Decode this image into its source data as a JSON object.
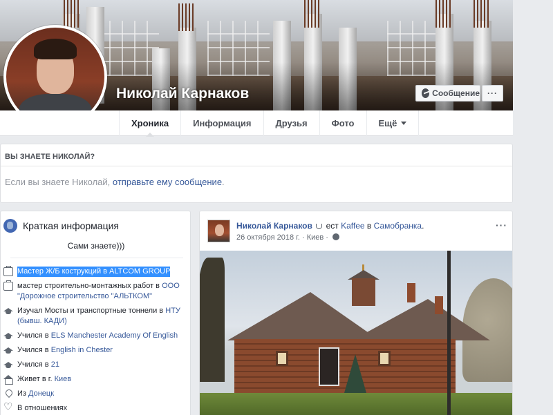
{
  "profile": {
    "name": "Николай Карнаков",
    "message_button": "Сообщение",
    "more_button": "···"
  },
  "tabs": [
    {
      "label": "Хроника"
    },
    {
      "label": "Информация"
    },
    {
      "label": "Друзья"
    },
    {
      "label": "Фото"
    },
    {
      "label": "Ещё"
    }
  ],
  "know": {
    "title": "ВЫ ЗНАЕТЕ НИКОЛАЙ?",
    "text_before": "Если вы знаете Николай, ",
    "link": "отправьте ему сообщение",
    "text_after": "."
  },
  "intro": {
    "title": "Краткая информация",
    "bio": "Сами знаете)))",
    "items": [
      {
        "icon": "briefcase-icon",
        "text": "Мастер Ж/Б кострукций в ALTCOM GROUP",
        "link": ""
      },
      {
        "icon": "briefcase-icon",
        "text": "мастер строительно-монтажных работ в ",
        "link": "ООО \"Дорожное строительство \"АЛЬТКОМ\""
      },
      {
        "icon": "graduation-cap-icon",
        "text": "Изучал Мосты и транспортные тоннели в ",
        "link": "НТУ (бывш. КАДИ)"
      },
      {
        "icon": "graduation-cap-icon",
        "text": "Учился в ",
        "link": "ELS Manchester Academy Of English"
      },
      {
        "icon": "graduation-cap-icon",
        "text": "Учился в ",
        "link": "English in Chester"
      },
      {
        "icon": "graduation-cap-icon",
        "text": "Учился в ",
        "link": "21"
      },
      {
        "icon": "home-icon",
        "text": "Живет в г. ",
        "link": "Киев"
      },
      {
        "icon": "map-pin-icon",
        "text": "Из ",
        "link": "Донецк"
      },
      {
        "icon": "heart-icon",
        "text": "В отношениях",
        "link": ""
      }
    ]
  },
  "post": {
    "author": "Николай Карнаков",
    "activity": "ест",
    "place": "Kaffee",
    "preposition": "в",
    "location": "Самобранка",
    "period": ".",
    "date": "26 октября 2018 г.",
    "separator": "·",
    "city": "Киев",
    "menu": "···"
  }
}
